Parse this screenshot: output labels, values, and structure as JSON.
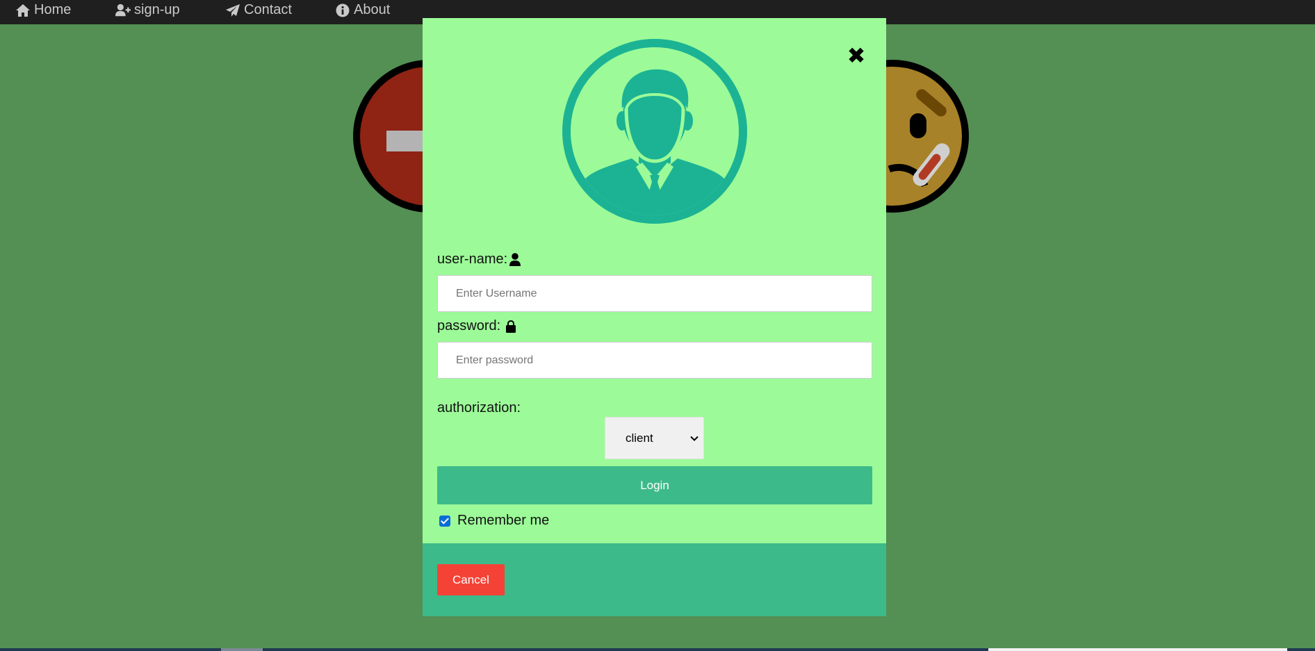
{
  "nav": {
    "items": [
      {
        "label": "Home",
        "icon": "home-icon"
      },
      {
        "label": "sign-up",
        "icon": "user-plus-icon"
      },
      {
        "label": "Contact",
        "icon": "paper-plane-icon"
      },
      {
        "label": "About",
        "icon": "info-circle-icon"
      }
    ]
  },
  "modal": {
    "close_glyph": "✖",
    "username": {
      "label": "user-name:",
      "placeholder": "Enter Username",
      "icon": "user-icon"
    },
    "password": {
      "label": "password:",
      "placeholder": "Enter password",
      "icon": "lock-icon"
    },
    "authorization": {
      "label": "authorization:",
      "selected": "client"
    },
    "login_label": "Login",
    "remember_label": "Remember me",
    "remember_checked": true,
    "cancel_label": "Cancel"
  },
  "colors": {
    "page_bg": "#548f54",
    "nav_bg": "#1f1f1f",
    "modal_bg": "#9cfb98",
    "accent": "#3dba8a",
    "avatar": "#1bb394",
    "cancel": "#f44336"
  }
}
